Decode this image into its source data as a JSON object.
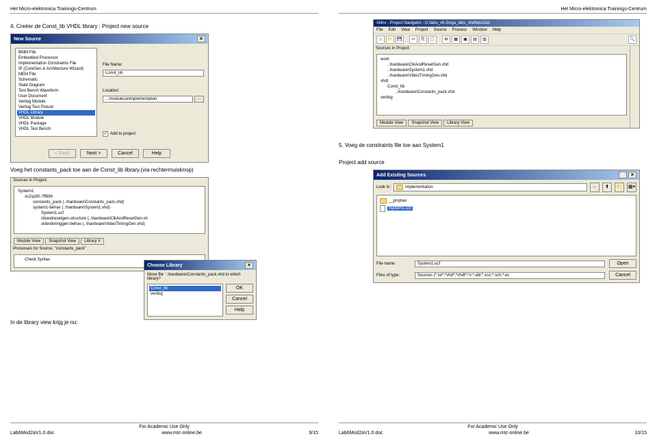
{
  "header_left": "Het Micro-elektronica Trainings-Centrum",
  "header_right": "Het Micro-elektronica Trainings-Centrum",
  "footer_academic": "For Academic Use Only",
  "footer_left_doc": "Lab6Mod2aV1.0.doc",
  "footer_url": "www.mtc-online.be",
  "footer_left_page": "9/15",
  "footer_right_doc": "Lab6Mod2aV1.0.doc",
  "footer_right_page": "10/15",
  "left_page": {
    "caption1": "4.  Creëer de Const_lib VHDL library : Project new source",
    "caption2": "Voeg het constants_pack toe aan de Const_lib library.(via rechtermuisknop)",
    "caption3": "In de library view krijg je nu:",
    "new_source": {
      "title": "New Source",
      "types": [
        "BMM File",
        "Embedded Processor",
        "Implementation Constraints File",
        "IP (CoreGen & Architecture Wizard)",
        "MEM File",
        "Schematic",
        "State Diagram",
        "Test Bench Waveform",
        "User Document",
        "Verilog Module",
        "Verilog Test Fixture",
        "VHDL Library",
        "VHDL Module",
        "VHDL Package",
        "VHDL Test Bench"
      ],
      "selected_type_index": 11,
      "file_name_label": "File Name:",
      "file_name_value": "Const_lib",
      "location_label": "Location:",
      "location_value": "...\\module2a\\implementation",
      "add_to_project": "Add to project",
      "btn_back": "< Back",
      "btn_next": "Next >",
      "btn_cancel": "Cancel",
      "btn_help": "Help"
    },
    "library_panel": {
      "sources_label": "Sources in Project:",
      "tree": [
        "System1",
        "xc2vp30-7ff896",
        "constants_pack (..\\hardware\\Constants_pack.vhd)",
        "system1-behav (..\\hardware\\System1.vhd)",
        "System1.ucf",
        "clkandresetgen-structure (..\\hardware\\ClkAndResetGen.vh",
        "videotiminggen-behav (..\\hardware\\VideoTimingGen.vhd)"
      ],
      "tab_module": "Module View",
      "tab_snapshot": "Snapshot View",
      "tab_library": "Library V",
      "processes_label": "Processes for Source: \"constants_pack\"",
      "process_item": "Check Syntax"
    },
    "choose_library": {
      "title": "Choose Library",
      "text": "Move file '..\\hardware\\Constants_pack.vhd to which library?",
      "items": [
        "Const_lib",
        "verilog"
      ],
      "btn_ok": "OK",
      "btn_cancel": "Cancel",
      "btn_help": "Help"
    }
  },
  "right_page": {
    "caption1": "5.  Voeg de constraints file toe aan System1",
    "caption2": "Project add source",
    "xilinx": {
      "title": "Xilinx - Project Navigator - D:\\labs_v6-3\\vga_labs_vhdl\\test2a\\i",
      "menu": [
        "File",
        "Edit",
        "View",
        "Project",
        "Source",
        "Process",
        "Window",
        "Help"
      ],
      "sources_label": "Sources in Project:",
      "tree_items": [
        "work",
        "..\\hardware\\ClkAndResetGen.vhd",
        "..\\hardware\\System1.vhd",
        "..\\hardware\\VideoTimingGen.vhd",
        "vhdl",
        "Const_lib",
        "..\\hardware\\Constants_pack.vhd",
        "verilog"
      ],
      "tab_module": "Module View",
      "tab_snapshot": "Snapshot View",
      "tab_library": "Library View"
    },
    "add_sources": {
      "title": "Add Existing Sources",
      "lookin_label": "Look in:",
      "lookin_value": "implementation",
      "files": [
        "__projnav",
        "System1.ucf"
      ],
      "filename_label": "File name:",
      "filename_value": "System1.ucf",
      "filetype_label": "Files of type:",
      "filetype_value": "Sources (*.txt*;*vhd*;*vhdl*;*v;*.abl;*.xco;*.sch;*.ec",
      "btn_open": "Open",
      "btn_cancel": "Cancel"
    }
  }
}
